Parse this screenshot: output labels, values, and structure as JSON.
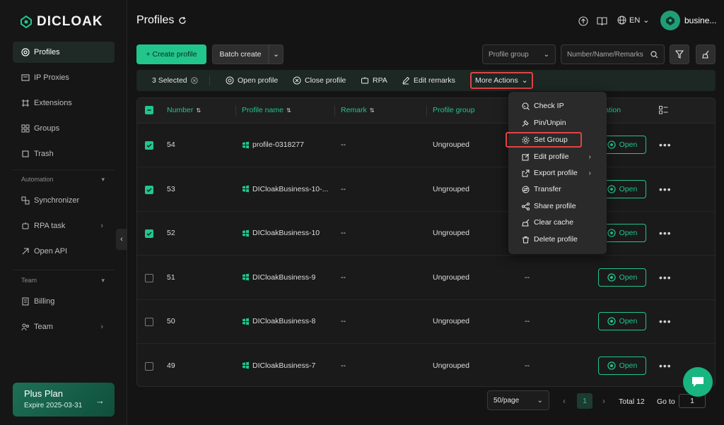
{
  "brand": {
    "name": "DICLOAK"
  },
  "sidebar": {
    "items": [
      {
        "label": "Profiles",
        "icon": "profiles-icon"
      },
      {
        "label": "IP Proxies",
        "icon": "proxy-icon"
      },
      {
        "label": "Extensions",
        "icon": "extensions-icon"
      },
      {
        "label": "Groups",
        "icon": "groups-icon"
      },
      {
        "label": "Trash",
        "icon": "trash-icon"
      }
    ],
    "automation_label": "Automation",
    "automation_items": [
      {
        "label": "Synchronizer"
      },
      {
        "label": "RPA task"
      },
      {
        "label": "Open API"
      }
    ],
    "team_label": "Team",
    "team_items": [
      {
        "label": "Billing"
      },
      {
        "label": "Team"
      }
    ],
    "plan": {
      "title": "Plus Plan",
      "expire": "Expire 2025-03-31"
    }
  },
  "header": {
    "title": "Profiles",
    "language": "EN",
    "user": "busine..."
  },
  "toolbar": {
    "create_label": "+ Create profile",
    "batch_label": "Batch create",
    "group_select": "Profile group",
    "search_placeholder": "Number/Name/Remarks"
  },
  "selection_bar": {
    "selected": "3 Selected",
    "open": "Open profile",
    "close": "Close profile",
    "rpa": "RPA",
    "edit_remarks": "Edit remarks",
    "more_actions": "More Actions"
  },
  "table": {
    "columns": [
      "Number",
      "Profile name",
      "Remark",
      "Profile group",
      "eration"
    ],
    "open_label": "Open",
    "rows": [
      {
        "number": "54",
        "name": "profile-0318277",
        "remark": "--",
        "group": "Ungrouped",
        "extra": "",
        "checked": true
      },
      {
        "number": "53",
        "name": "DICloakBusiness-10-...",
        "remark": "--",
        "group": "Ungrouped",
        "extra": "",
        "checked": true
      },
      {
        "number": "52",
        "name": "DICloakBusiness-10",
        "remark": "--",
        "group": "Ungrouped",
        "extra": "",
        "checked": true
      },
      {
        "number": "51",
        "name": "DICloakBusiness-9",
        "remark": "--",
        "group": "Ungrouped",
        "extra": "--",
        "checked": false
      },
      {
        "number": "50",
        "name": "DICloakBusiness-8",
        "remark": "--",
        "group": "Ungrouped",
        "extra": "--",
        "checked": false
      },
      {
        "number": "49",
        "name": "DICloakBusiness-7",
        "remark": "--",
        "group": "Ungrouped",
        "extra": "--",
        "checked": false
      }
    ]
  },
  "menu": {
    "items": [
      {
        "label": "Check IP"
      },
      {
        "label": "Pin/Unpin"
      },
      {
        "label": "Set Group"
      },
      {
        "label": "Edit profile"
      },
      {
        "label": "Export profile"
      },
      {
        "label": "Transfer"
      },
      {
        "label": "Share profile"
      },
      {
        "label": "Clear cache"
      },
      {
        "label": "Delete profile"
      }
    ]
  },
  "pagination": {
    "per_page": "50/page",
    "current": "1",
    "total": "Total 12",
    "goto_label": "Go to",
    "goto_value": "1"
  },
  "colors": {
    "accent": "#22c58b",
    "highlight": "#e04444",
    "background": "#141414"
  }
}
